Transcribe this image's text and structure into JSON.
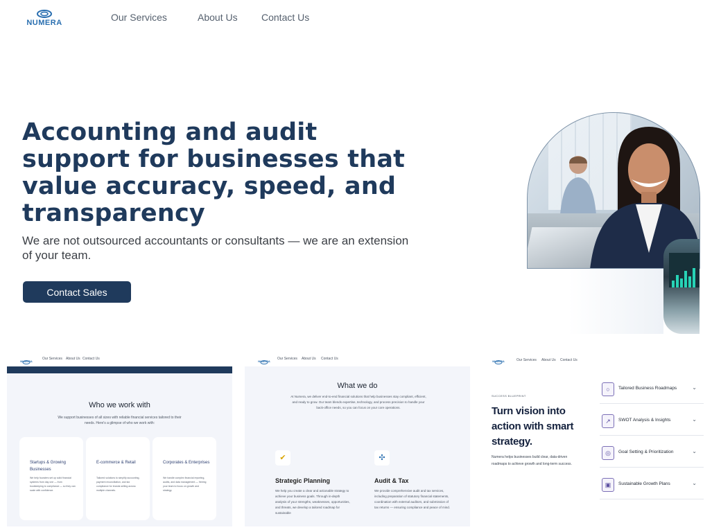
{
  "brand": {
    "name": "NUMERA"
  },
  "nav": {
    "links": [
      "Our Services",
      "About Us",
      "Contact Us"
    ]
  },
  "hero": {
    "title": "Accounting and audit support for businesses that value accuracy, speed, and transparency",
    "subtitle": "We are not outsourced accountants or consultants — we are an extension of your team.",
    "cta": "Contact Sales"
  },
  "thumbs": [
    {
      "nav": {
        "brand": "NUMERA",
        "links": [
          "Our Services",
          "About Us",
          "Contact Us"
        ]
      },
      "title": "Who we work with",
      "subtitle": "We support businesses of all sizes with reliable financial services tailored to their needs. Here's a glimpse of who we work with:",
      "cards": [
        {
          "title": "Startups & Growing Businesses",
          "text": "We help founders set up solid financial systems from day one — from bookkeeping to compliance — so they can scale with confidence."
        },
        {
          "title": "E-commerce & Retail",
          "text": "Tailored solutions to simplify accounting, payment reconciliation, and tax compliance for brands selling across multiple channels."
        },
        {
          "title": "Corporates & Enterprises",
          "text": "We handle complex financial reporting, audits, and data management — freeing your team to focus on growth and strategy."
        }
      ]
    },
    {
      "nav": {
        "brand": "NUMERA",
        "links": [
          "Our Services",
          "About Us",
          "Contact Us"
        ]
      },
      "title": "What we do",
      "subtitle": "At Numera, we deliver end-to-end financial solutions that help businesses stay compliant, efficient, and ready to grow. Our team blends expertise, technology, and process precision to handle your back-office needs, so you can focus on your core operations.",
      "services": [
        {
          "icon": "target-icon",
          "title": "Strategic Planning",
          "text": "We help you create a clear and actionable strategy to achieve your business goals. Through in-depth analysis of your strengths, weaknesses, opportunities, and threats, we develop a tailored roadmap for sustainable"
        },
        {
          "icon": "audit-icon",
          "title": "Audit & Tax",
          "text": "We provide comprehensive audit and tax services, including preparation of statutory financial statements, coordination with external auditors, and submission of tax returns — ensuring compliance and peace of mind."
        }
      ]
    },
    {
      "nav": {
        "brand": "NUMERA",
        "links": [
          "Our Services",
          "About Us",
          "Contact Us"
        ]
      },
      "eyebrow": "SUCCESS BLUEPRINT",
      "title": "Turn vision into action with smart strategy.",
      "subtitle": "Numera helps businesses build clear, data-driven roadmaps to achieve growth and long-term success.",
      "items": [
        {
          "icon": "lightbulb-icon",
          "label": "Tailored Business Roadmaps"
        },
        {
          "icon": "chart-icon",
          "label": "SWOT Analysis & Insights"
        },
        {
          "icon": "target-icon",
          "label": "Goal Setting & Prioritization"
        },
        {
          "icon": "growth-icon",
          "label": "Sustainable Growth Plans"
        }
      ]
    }
  ]
}
